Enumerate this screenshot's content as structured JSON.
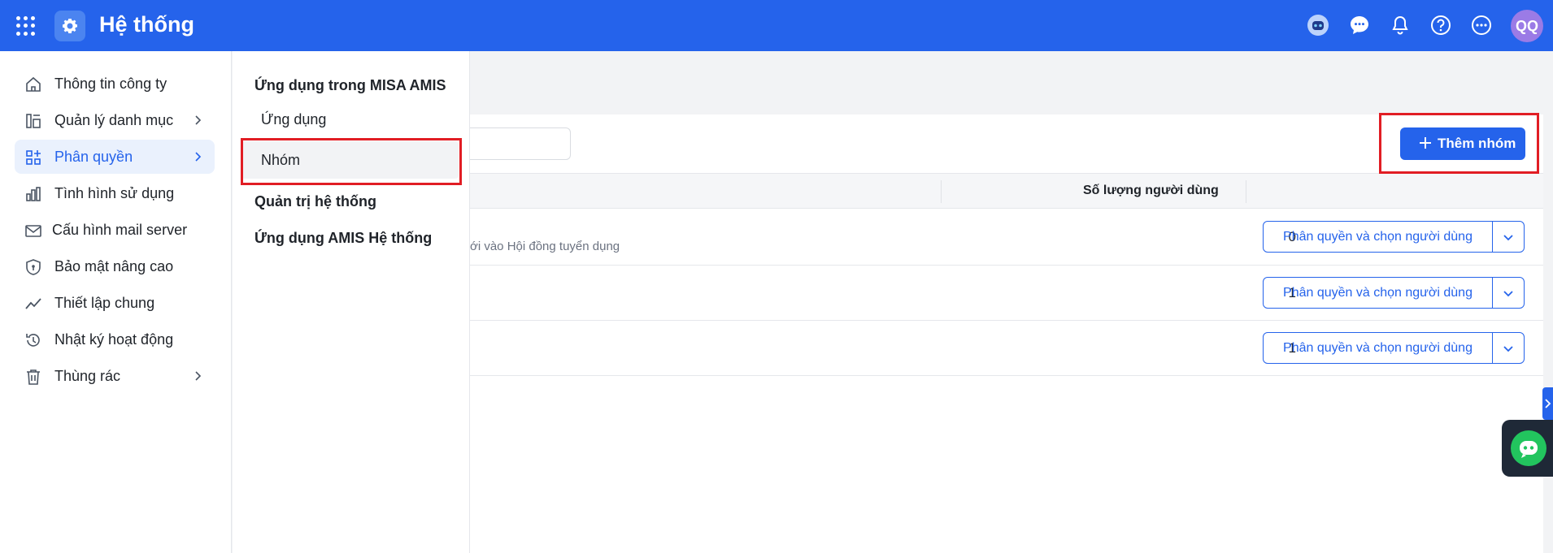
{
  "header": {
    "title": "Hệ thống",
    "avatar_initials": "QQ",
    "icons": [
      "apps-grid-icon",
      "settings-gear-icon",
      "assistant-bot-icon",
      "chat-icon",
      "bell-icon",
      "help-icon",
      "more-icon"
    ]
  },
  "sidebar": {
    "items": [
      {
        "label": "Thông tin công ty",
        "icon": "home-icon"
      },
      {
        "label": "Quản lý danh mục",
        "icon": "catalog-icon"
      },
      {
        "label": "Phân quyền",
        "icon": "permission-icon"
      },
      {
        "label": "Tình hình sử dụng",
        "icon": "bar-chart-icon"
      },
      {
        "label": "Cấu hình mail server",
        "icon": "mail-icon"
      },
      {
        "label": "Bảo mật nâng cao",
        "icon": "shield-icon"
      },
      {
        "label": "Thiết lập chung",
        "icon": "trend-icon"
      },
      {
        "label": "Nhật ký hoạt động",
        "icon": "history-icon"
      },
      {
        "label": "Thùng rác",
        "icon": "trash-icon"
      }
    ]
  },
  "submenu": {
    "section1": "Ứng dụng trong MISA AMIS",
    "item_apps": "Ứng dụng",
    "item_groups": "Nhóm",
    "section2": "Quản trị hệ thống",
    "section3": "Ứng dụng AMIS Hệ thống"
  },
  "main": {
    "add_button": "Thêm nhóm",
    "column_users": "Số lượng người dùng",
    "rows": [
      {
        "desc": "ới vào Hội đồng tuyển dụng",
        "count": "0",
        "action": "Phân quyền và chọn người dùng"
      },
      {
        "desc": "",
        "count": "1",
        "action": "Phân quyền và chọn người dùng"
      },
      {
        "desc": "",
        "count": "1",
        "action": "Phân quyền và chọn người dùng"
      }
    ]
  },
  "colors": {
    "primary": "#2563eb",
    "highlight": "#e11d24",
    "avatar": "#9b7be6"
  }
}
